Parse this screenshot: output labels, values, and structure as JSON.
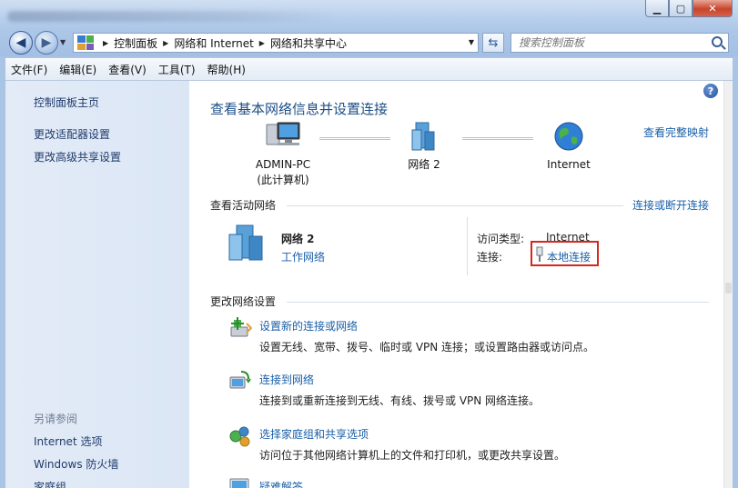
{
  "window": {
    "controls": {
      "minimize": "▁",
      "maximize": "▢",
      "close": "✕"
    }
  },
  "address": {
    "breadcrumbs": [
      "控制面板",
      "网络和 Internet",
      "网络和共享中心"
    ],
    "search_placeholder": "搜索控制面板"
  },
  "menu": [
    "文件(F)",
    "编辑(E)",
    "查看(V)",
    "工具(T)",
    "帮助(H)"
  ],
  "sidebar": {
    "links": [
      "控制面板主页",
      "更改适配器设置",
      "更改高级共享设置"
    ],
    "see_also_title": "另请参阅",
    "see_also": [
      "Internet 选项",
      "Windows 防火墙",
      "家庭组"
    ]
  },
  "main": {
    "heading": "查看基本网络信息并设置连接",
    "view_full_map": "查看完整映射",
    "network_map": {
      "computer_name": "ADMIN-PC",
      "computer_sub": "(此计算机)",
      "network_name": "网络  2",
      "internet": "Internet"
    },
    "active_networks": {
      "title": "查看活动网络",
      "connect_disconnect": "连接或断开连接",
      "name": "网络  2",
      "type": "工作网络",
      "access_type_label": "访问类型:",
      "access_type_value": "Internet",
      "connection_label": "连接:",
      "connection_value": "本地连接"
    },
    "change_settings": {
      "title": "更改网络设置",
      "tasks": [
        {
          "title": "设置新的连接或网络",
          "desc": "设置无线、宽带、拨号、临时或 VPN 连接；或设置路由器或访问点。",
          "icon": "new-connection-icon"
        },
        {
          "title": "连接到网络",
          "desc": "连接到或重新连接到无线、有线、拨号或 VPN 网络连接。",
          "icon": "connect-network-icon"
        },
        {
          "title": "选择家庭组和共享选项",
          "desc": "访问位于其他网络计算机上的文件和打印机，或更改共享设置。",
          "icon": "homegroup-icon"
        },
        {
          "title": "疑难解答",
          "desc": "",
          "icon": "troubleshoot-icon"
        }
      ]
    }
  },
  "colors": {
    "link": "#1a5fa8",
    "heading": "#1d4e86",
    "highlight": "#d4271e"
  }
}
